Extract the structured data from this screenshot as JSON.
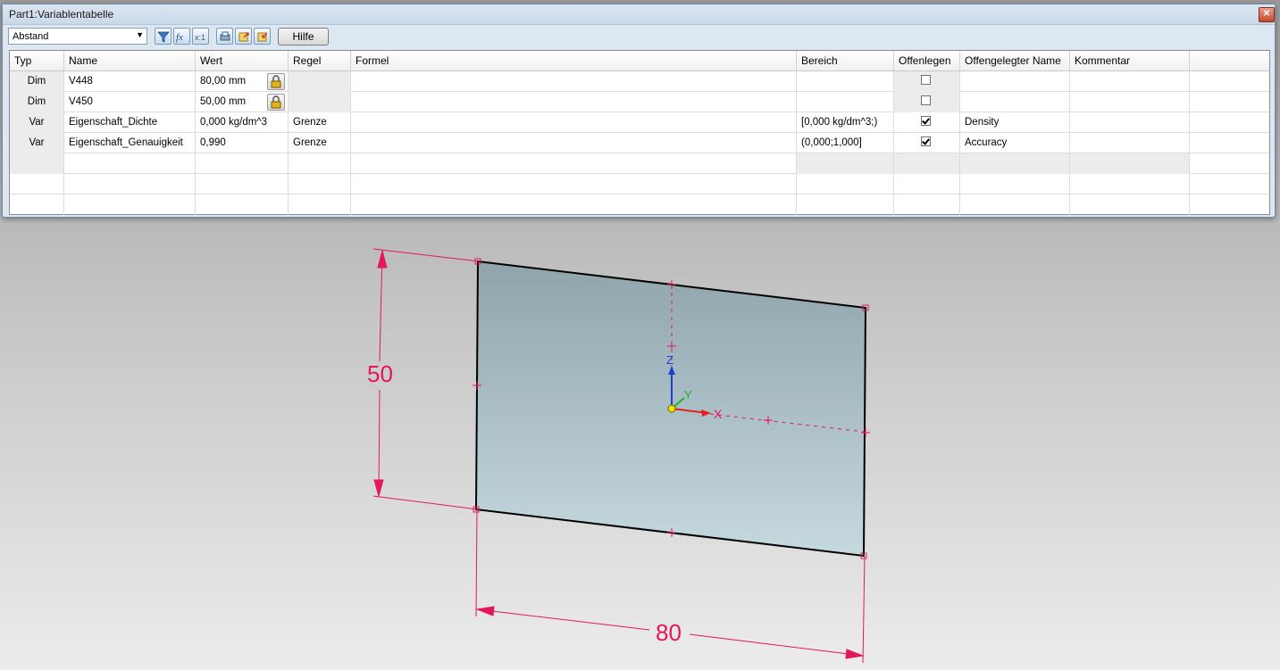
{
  "window": {
    "title": "Part1:Variablentabelle",
    "close_glyph": "✕"
  },
  "toolbar": {
    "filter_dropdown_value": "Abstand",
    "help_label": "Hilfe",
    "icons": [
      "filter-icon",
      "formula-icon",
      "function-icon",
      "print-icon",
      "export-icon",
      "import-icon"
    ]
  },
  "table": {
    "headers": [
      "Typ",
      "Name",
      "Wert",
      "Regel",
      "Formel",
      "Bereich",
      "Offenlegen",
      "Offengelegter Name",
      "Kommentar"
    ],
    "rows": [
      {
        "typ": "Dim",
        "name": "V448",
        "wert": "80,00 mm",
        "regel": "",
        "formel": "",
        "bereich": "",
        "offenlegen": false,
        "offengelegter_name": "",
        "kommentar": "",
        "locked": true
      },
      {
        "typ": "Dim",
        "name": "V450",
        "wert": "50,00 mm",
        "regel": "",
        "formel": "",
        "bereich": "",
        "offenlegen": false,
        "offengelegter_name": "",
        "kommentar": "",
        "locked": true
      },
      {
        "typ": "Var",
        "name": "Eigenschaft_Dichte",
        "wert": "0,000 kg/dm^3",
        "regel": "Grenze",
        "formel": "",
        "bereich": "[0,000 kg/dm^3;)",
        "offenlegen": true,
        "offengelegter_name": "Density",
        "kommentar": "",
        "locked": false
      },
      {
        "typ": "Var",
        "name": "Eigenschaft_Genauigkeit",
        "wert": "0,990",
        "regel": "Grenze",
        "formel": "",
        "bereich": "(0,000;1,000]",
        "offenlegen": true,
        "offengelegter_name": "Accuracy",
        "kommentar": "",
        "locked": false
      }
    ]
  },
  "sketch": {
    "dimension_height": "50",
    "dimension_width": "80",
    "axis_x": "X",
    "axis_y": "Y",
    "axis_z": "Z",
    "accent_color": "#e4175c",
    "plane_color": "#a9c0c6"
  }
}
